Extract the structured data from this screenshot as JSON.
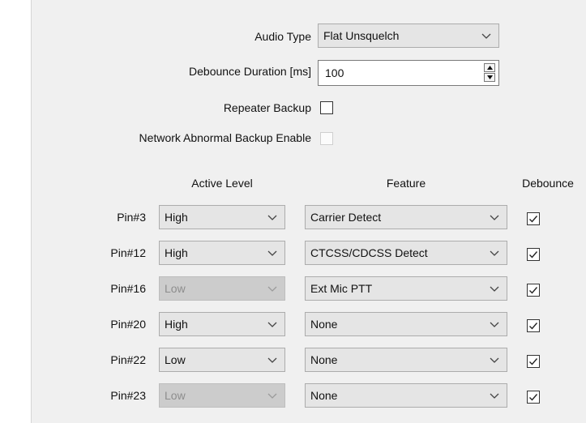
{
  "audio_type": {
    "label": "Audio Type",
    "value": "Flat Unsquelch"
  },
  "debounce_duration": {
    "label": "Debounce Duration [ms]",
    "value": "100"
  },
  "repeater_backup": {
    "label": "Repeater Backup",
    "checked": false
  },
  "network_abnormal_backup": {
    "label": "Network Abnormal Backup Enable",
    "checked": false,
    "enabled": false
  },
  "columns": {
    "active_level": "Active Level",
    "feature": "Feature",
    "debounce": "Debounce"
  },
  "pins": [
    {
      "label": "Pin#3",
      "active_level": "High",
      "level_enabled": true,
      "feature": "Carrier Detect",
      "debounce": true
    },
    {
      "label": "Pin#12",
      "active_level": "High",
      "level_enabled": true,
      "feature": "CTCSS/CDCSS Detect",
      "debounce": true
    },
    {
      "label": "Pin#16",
      "active_level": "Low",
      "level_enabled": false,
      "feature": "Ext Mic PTT",
      "debounce": true
    },
    {
      "label": "Pin#20",
      "active_level": "High",
      "level_enabled": true,
      "feature": "None",
      "debounce": true
    },
    {
      "label": "Pin#22",
      "active_level": "Low",
      "level_enabled": true,
      "feature": "None",
      "debounce": true
    },
    {
      "label": "Pin#23",
      "active_level": "Low",
      "level_enabled": false,
      "feature": "None",
      "debounce": true
    }
  ]
}
